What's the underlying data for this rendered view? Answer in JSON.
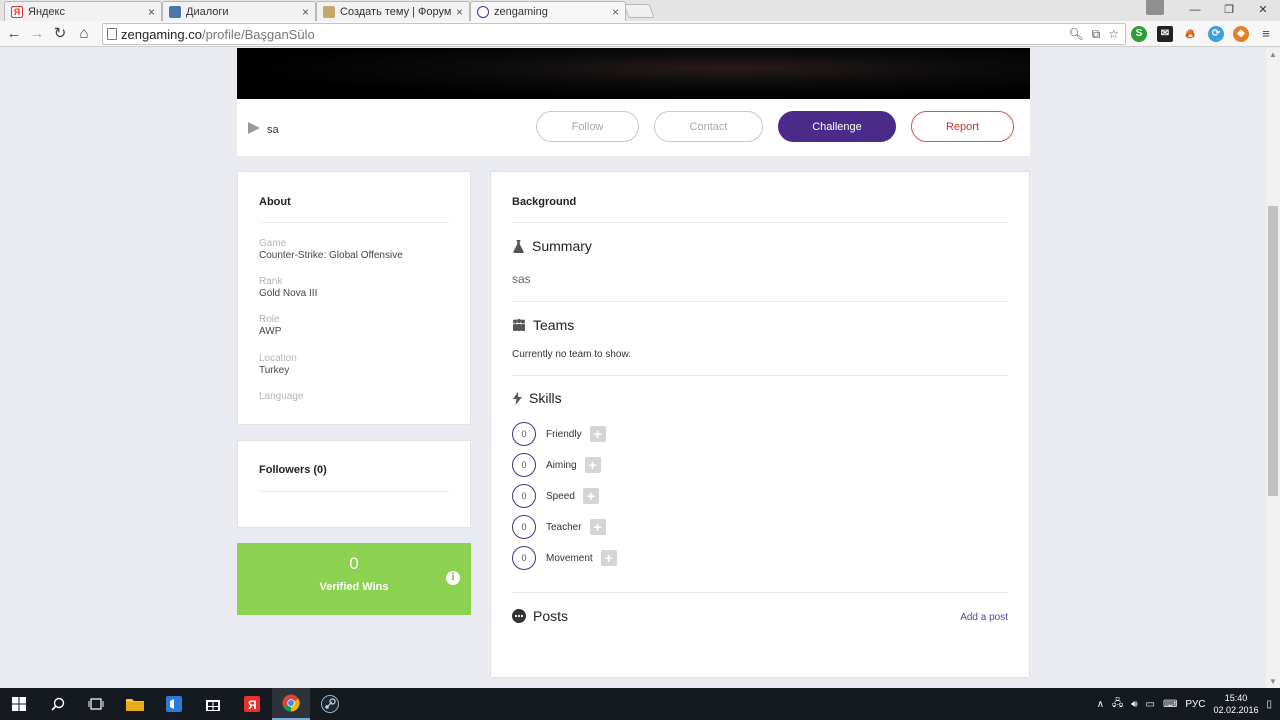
{
  "browser": {
    "tabs": [
      {
        "title": "Яндекс",
        "favicon": "yandex-icon",
        "color": "#e8322a"
      },
      {
        "title": "Диалоги",
        "favicon": "vk-icon",
        "color": "#4a76a8"
      },
      {
        "title": "Создать тему | Форум Ma",
        "favicon": "forum-avatar-icon",
        "color": "#6b5a3a"
      },
      {
        "title": "zengaming",
        "favicon": "zengaming-icon",
        "color": "#4b2b8a"
      }
    ],
    "url_host": "zengaming.co",
    "url_path": "/profile/BaşganSülo",
    "window_controls": [
      "—",
      "❐",
      "✕"
    ]
  },
  "profile": {
    "username": "sa",
    "buttons": {
      "follow": "Follow",
      "contact": "Contact",
      "challenge": "Challenge",
      "report": "Report"
    }
  },
  "about": {
    "title": "About",
    "fields": [
      {
        "label": "Game",
        "value": "Counter-Strike: Global Offensive"
      },
      {
        "label": "Rank",
        "value": "Gold Nova III"
      },
      {
        "label": "Role",
        "value": "AWP"
      },
      {
        "label": "Location",
        "value": "Turkey"
      },
      {
        "label": "Language",
        "value": ""
      }
    ]
  },
  "followers": {
    "title": "Followers (0)"
  },
  "wins": {
    "count": "0",
    "label": "Verified Wins"
  },
  "background": {
    "title": "Background",
    "summary": {
      "heading": "Summary",
      "text": "sas"
    },
    "teams": {
      "heading": "Teams",
      "text": "Currently no team to show."
    },
    "skills": {
      "heading": "Skills",
      "items": [
        {
          "name": "Friendly",
          "count": "0"
        },
        {
          "name": "Aiming",
          "count": "0"
        },
        {
          "name": "Speed",
          "count": "0"
        },
        {
          "name": "Teacher",
          "count": "0"
        },
        {
          "name": "Movement",
          "count": "0"
        }
      ]
    },
    "posts": {
      "heading": "Posts",
      "add_label": "Add a post"
    }
  },
  "taskbar": {
    "language": "РУС",
    "time": "15:40",
    "date": "02.02.2016"
  },
  "colors": {
    "accent": "#4b2b8a",
    "wins_green": "#8cd150",
    "report_red": "#d9534f"
  }
}
